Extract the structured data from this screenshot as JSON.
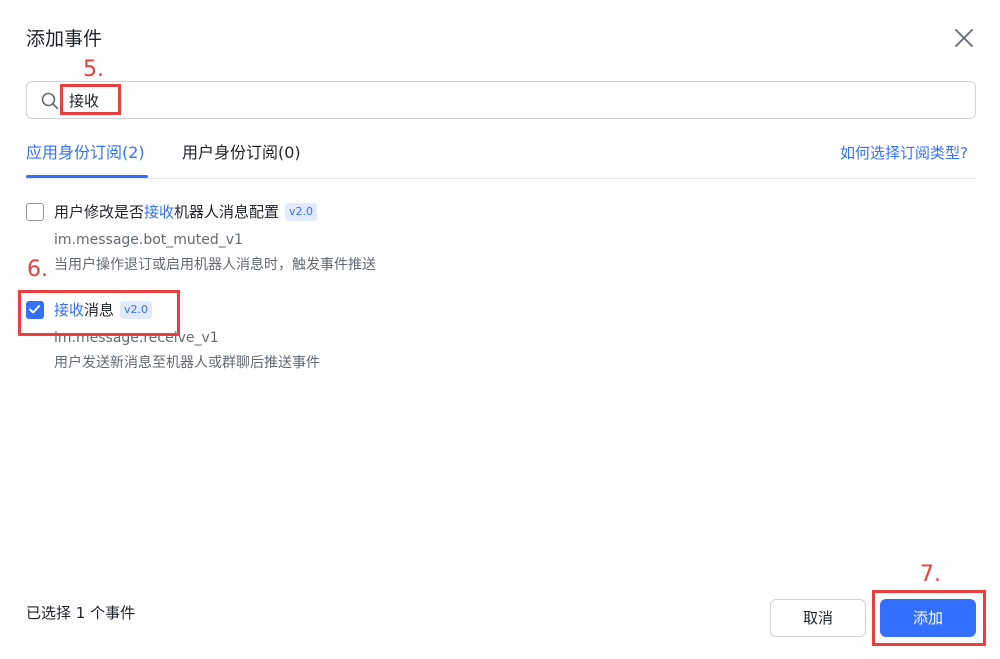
{
  "dialog": {
    "title": "添加事件",
    "close_icon": "close-icon"
  },
  "search": {
    "icon": "search-icon",
    "value": "接收",
    "placeholder": ""
  },
  "tabs": [
    {
      "label": "应用身份订阅(2)",
      "active": true
    },
    {
      "label": "用户身份订阅(0)",
      "active": false
    }
  ],
  "help_link": "如何选择订阅类型?",
  "events": [
    {
      "name_before": "用户修改是否",
      "name_highlight": "接收",
      "name_after": "机器人消息配置",
      "version": "v2.0",
      "key": "im.message.bot_muted_v1",
      "description": "当用户操作退订或启用机器人消息时，触发事件推送",
      "checked": false
    },
    {
      "name_before": "",
      "name_highlight": "接收",
      "name_after": "消息",
      "version": "v2.0",
      "key": "im.message.receive_v1",
      "description": "用户发送新消息至机器人或群聊后推送事件",
      "checked": true
    }
  ],
  "annotations": [
    "5.",
    "6.",
    "7."
  ],
  "footer": {
    "selected_count": "已选择 1 个事件",
    "cancel_label": "取消",
    "add_label": "添加"
  },
  "colors": {
    "accent": "#3370ff",
    "annotation": "#e8403f",
    "badge_bg": "#e1eaff"
  }
}
